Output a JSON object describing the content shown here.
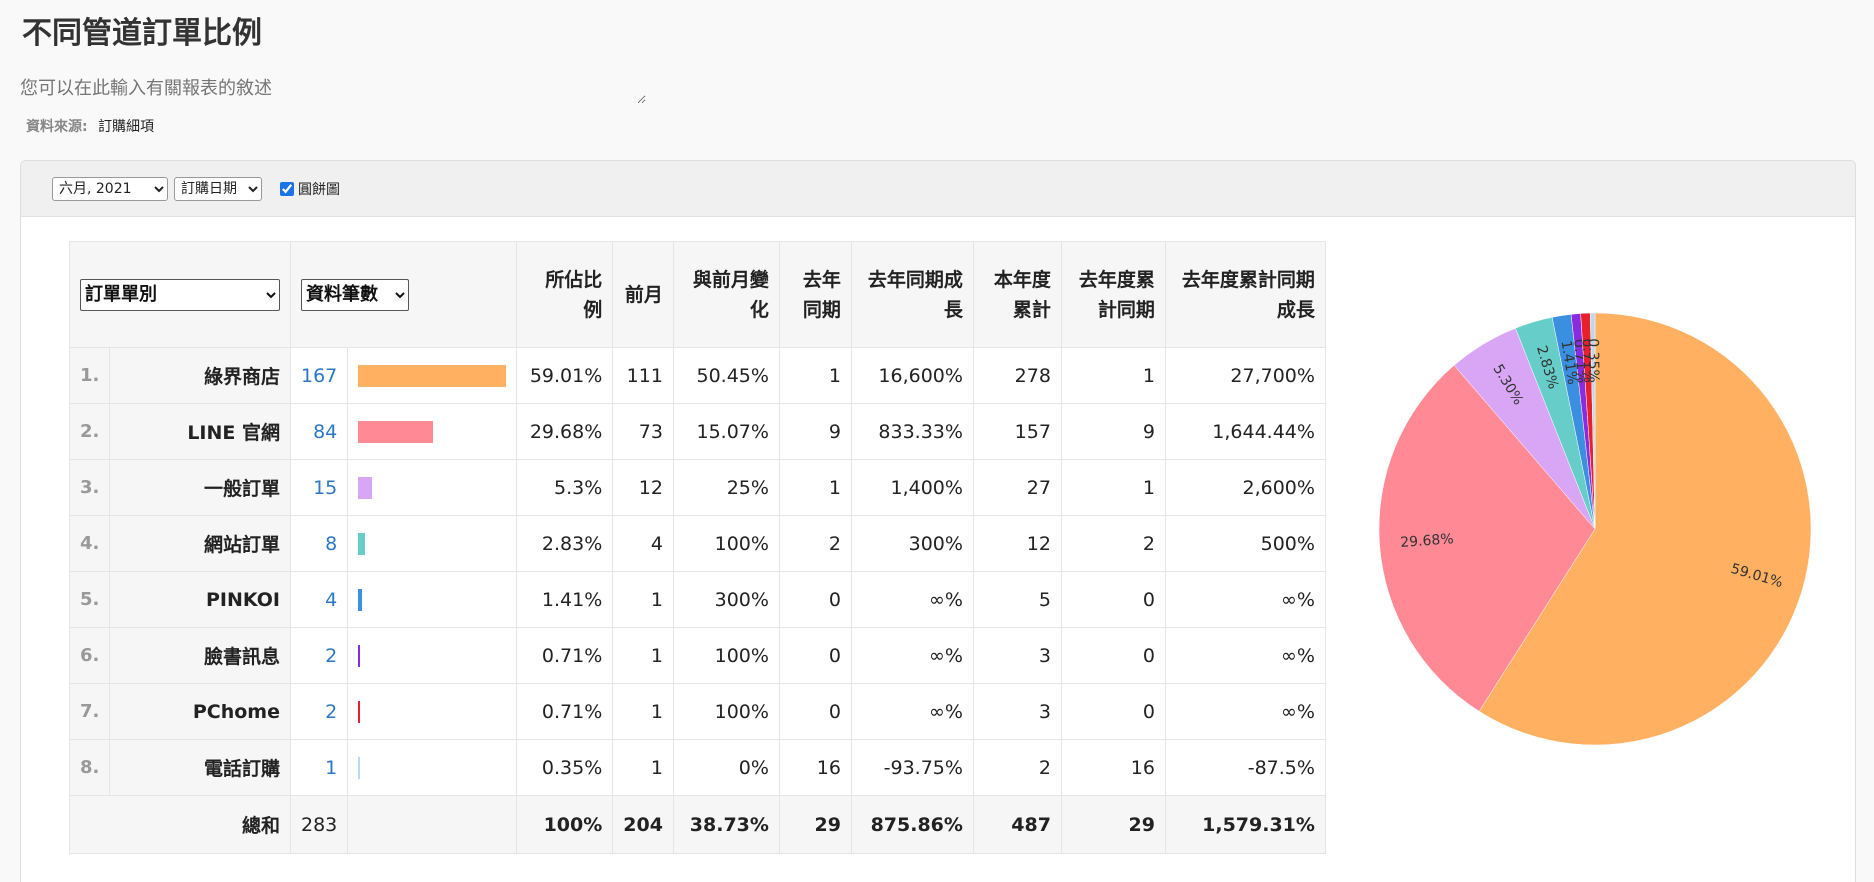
{
  "header": {
    "title": "不同管道訂單比例",
    "description_placeholder": "您可以在此輸入有關報表的敘述",
    "source_label": "資料來源:",
    "source_value": "訂購細項"
  },
  "toolbar": {
    "month_value": "六月, 2021",
    "date_field_value": "訂購日期",
    "pie_checkbox_label": "圓餅圖",
    "pie_checked": true
  },
  "table": {
    "group_select_value": "訂單單別",
    "metric_select_value": "資料筆數",
    "columns": [
      "所佔比例",
      "前月",
      "與前月變化",
      "去年同期",
      "去年同期成長",
      "本年度累計",
      "去年度累計同期",
      "去年度累計同期成長"
    ],
    "rows": [
      {
        "rank": "1.",
        "name": "綠界商店",
        "count": "167",
        "share": "59.01%",
        "prev_month": "111",
        "mom_change": "50.45%",
        "last_year": "1",
        "yoy_growth": "16,600%",
        "ytd": "278",
        "last_ytd": "1",
        "ytd_growth": "27,700%"
      },
      {
        "rank": "2.",
        "name": "LINE 官網",
        "count": "84",
        "share": "29.68%",
        "prev_month": "73",
        "mom_change": "15.07%",
        "last_year": "9",
        "yoy_growth": "833.33%",
        "ytd": "157",
        "last_ytd": "9",
        "ytd_growth": "1,644.44%"
      },
      {
        "rank": "3.",
        "name": "一般訂單",
        "count": "15",
        "share": "5.3%",
        "prev_month": "12",
        "mom_change": "25%",
        "last_year": "1",
        "yoy_growth": "1,400%",
        "ytd": "27",
        "last_ytd": "1",
        "ytd_growth": "2,600%"
      },
      {
        "rank": "4.",
        "name": "網站訂單",
        "count": "8",
        "share": "2.83%",
        "prev_month": "4",
        "mom_change": "100%",
        "last_year": "2",
        "yoy_growth": "300%",
        "ytd": "12",
        "last_ytd": "2",
        "ytd_growth": "500%"
      },
      {
        "rank": "5.",
        "name": "PINKOI",
        "count": "4",
        "share": "1.41%",
        "prev_month": "1",
        "mom_change": "300%",
        "last_year": "0",
        "yoy_growth": "∞%",
        "ytd": "5",
        "last_ytd": "0",
        "ytd_growth": "∞%"
      },
      {
        "rank": "6.",
        "name": "臉書訊息",
        "count": "2",
        "share": "0.71%",
        "prev_month": "1",
        "mom_change": "100%",
        "last_year": "0",
        "yoy_growth": "∞%",
        "ytd": "3",
        "last_ytd": "0",
        "ytd_growth": "∞%"
      },
      {
        "rank": "7.",
        "name": "PChome",
        "count": "2",
        "share": "0.71%",
        "prev_month": "1",
        "mom_change": "100%",
        "last_year": "0",
        "yoy_growth": "∞%",
        "ytd": "3",
        "last_ytd": "0",
        "ytd_growth": "∞%"
      },
      {
        "rank": "8.",
        "name": "電話訂購",
        "count": "1",
        "share": "0.35%",
        "prev_month": "1",
        "mom_change": "0%",
        "last_year": "16",
        "yoy_growth": "-93.75%",
        "ytd": "2",
        "last_ytd": "16",
        "ytd_growth": "-87.5%"
      }
    ],
    "total": {
      "name": "總和",
      "count": "283",
      "share": "100%",
      "prev_month": "204",
      "mom_change": "38.73%",
      "last_year": "29",
      "yoy_growth": "875.86%",
      "ytd": "487",
      "last_ytd": "29",
      "ytd_growth": "1,579.31%"
    }
  },
  "chart_data": {
    "type": "pie",
    "categories": [
      "綠界商店",
      "LINE 官網",
      "一般訂單",
      "網站訂單",
      "PINKOI",
      "臉書訊息",
      "PChome",
      "電話訂購"
    ],
    "values": [
      167,
      84,
      15,
      8,
      4,
      2,
      2,
      1
    ],
    "slice_labels": [
      "59.01%",
      "29.68%",
      "5.30%",
      "2.83%",
      "1.41%",
      "0.71%",
      "0.71%",
      "0.35%"
    ],
    "colors": [
      "#ffb061",
      "#ff8a96",
      "#d8a6f5",
      "#66cdc8",
      "#3a8fe0",
      "#8b2be0",
      "#e8202c",
      "#bcd9ee"
    ],
    "max_value": 167
  }
}
